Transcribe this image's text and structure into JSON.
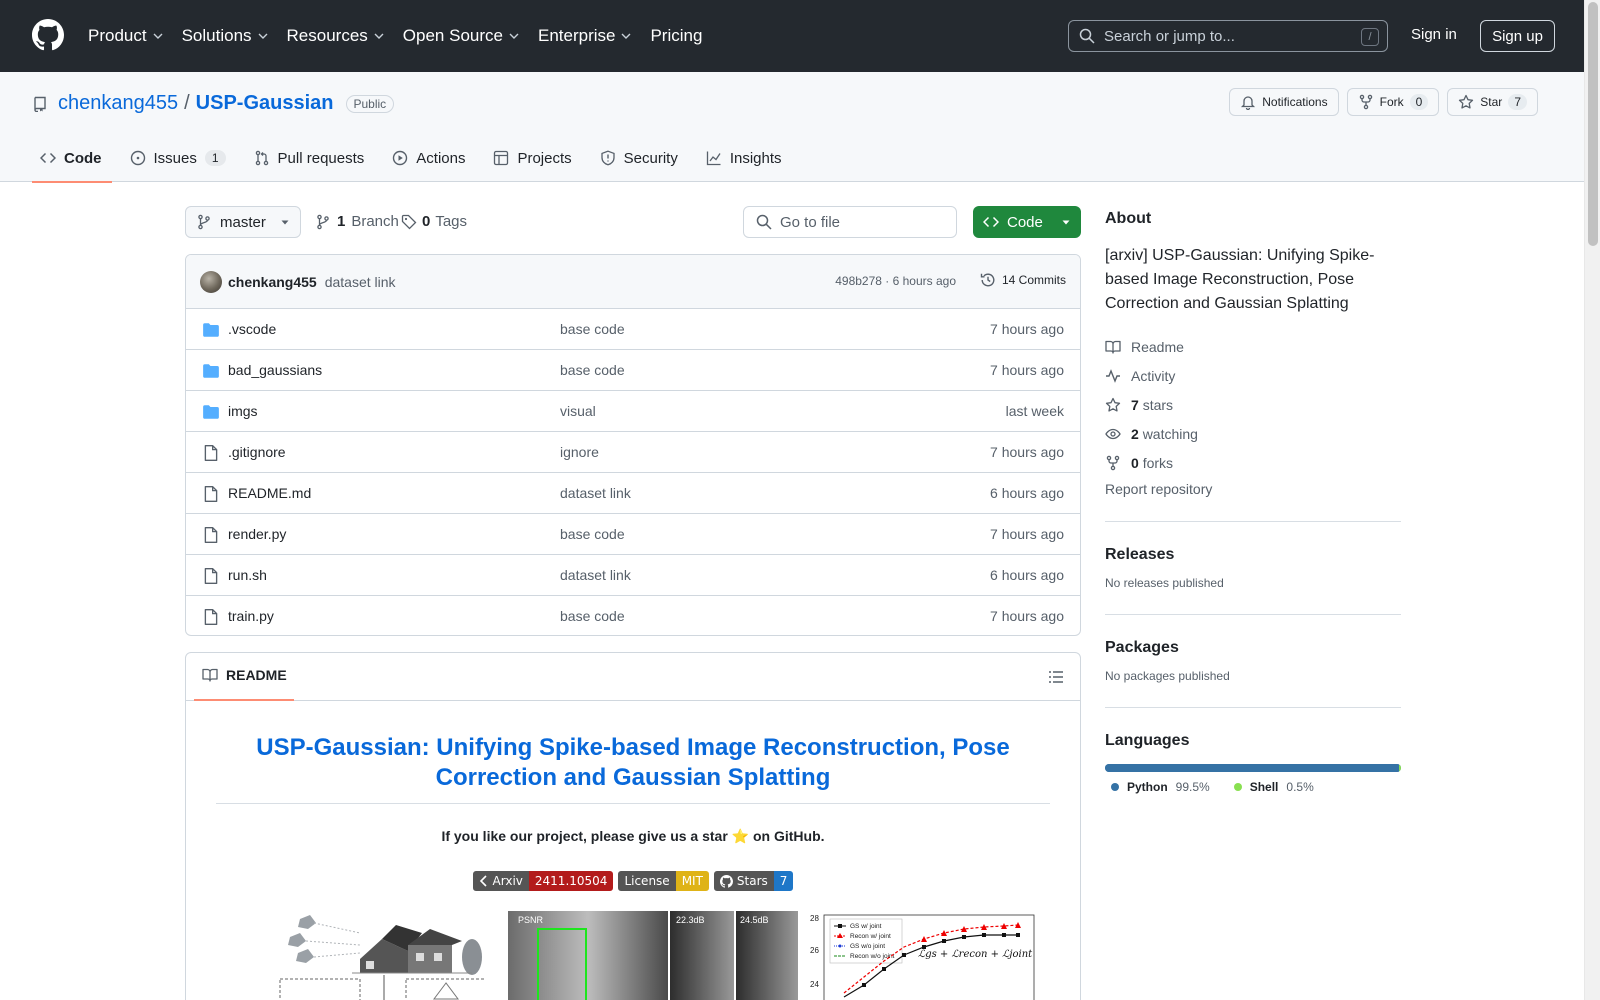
{
  "header": {
    "nav": [
      "Product",
      "Solutions",
      "Resources",
      "Open Source",
      "Enterprise",
      "Pricing"
    ],
    "search_placeholder": "Search or jump to...",
    "search_shortcut": "/",
    "sign_in": "Sign in",
    "sign_up": "Sign up"
  },
  "repo": {
    "owner": "chenkang455",
    "separator": "/",
    "name": "USP-Gaussian",
    "visibility": "Public",
    "notifications_label": "Notifications",
    "fork_label": "Fork",
    "fork_count": "0",
    "star_label": "Star",
    "star_count": "7",
    "tabs": [
      {
        "label": "Code"
      },
      {
        "label": "Issues",
        "count": "1"
      },
      {
        "label": "Pull requests"
      },
      {
        "label": "Actions"
      },
      {
        "label": "Projects"
      },
      {
        "label": "Security"
      },
      {
        "label": "Insights"
      }
    ]
  },
  "toolbar": {
    "branch": "master",
    "branch_count": "1",
    "branch_label": "Branch",
    "tag_count": "0",
    "tag_label": "Tags",
    "goto_placeholder": "Go to file",
    "code_label": "Code"
  },
  "latest_commit": {
    "author": "chenkang455",
    "message": "dataset link",
    "meta": "498b278 · 6 hours ago",
    "commits_label": "14 Commits"
  },
  "files": [
    {
      "type": "folder",
      "name": ".vscode",
      "commit": "base code",
      "time": "7 hours ago"
    },
    {
      "type": "folder",
      "name": "bad_gaussians",
      "commit": "base code",
      "time": "7 hours ago"
    },
    {
      "type": "folder",
      "name": "imgs",
      "commit": "visual",
      "time": "last week"
    },
    {
      "type": "file",
      "name": ".gitignore",
      "commit": "ignore",
      "time": "7 hours ago"
    },
    {
      "type": "file",
      "name": "README.md",
      "commit": "dataset link",
      "time": "6 hours ago"
    },
    {
      "type": "file",
      "name": "render.py",
      "commit": "base code",
      "time": "7 hours ago"
    },
    {
      "type": "file",
      "name": "run.sh",
      "commit": "dataset link",
      "time": "6 hours ago"
    },
    {
      "type": "file",
      "name": "train.py",
      "commit": "base code",
      "time": "7 hours ago"
    }
  ],
  "readme": {
    "tab_label": "README",
    "title": "USP-Gaussian: Unifying Spike-based Image Reconstruction, Pose Correction and Gaussian Splatting",
    "star_note": "If you like our project, please give us a star ⭐ on GitHub.",
    "badges": [
      {
        "left": "Arxiv",
        "right": "2411.10504"
      },
      {
        "left": "License",
        "right": "MIT"
      },
      {
        "left": "Stars",
        "right": "7"
      }
    ],
    "figure_labels": {
      "psnr": "PSNR",
      "db1": "22.3dB",
      "db2": "24.5dB",
      "y_ticks": [
        "28",
        "26",
        "24"
      ],
      "legend": [
        "GS w/ joint",
        "Recon w/ joint",
        "GS w/o joint",
        "Recon w/o joint"
      ]
    }
  },
  "about": {
    "heading": "About",
    "description": "[arxiv] USP-Gaussian: Unifying Spike-based Image Reconstruction, Pose Correction and Gaussian Splatting",
    "readme": "Readme",
    "activity": "Activity",
    "stars_count": "7",
    "stars_label": "stars",
    "watching_count": "2",
    "watching_label": "watching",
    "forks_count": "0",
    "forks_label": "forks",
    "report": "Report repository"
  },
  "releases": {
    "heading": "Releases",
    "empty": "No releases published"
  },
  "packages": {
    "heading": "Packages",
    "empty": "No packages published"
  },
  "languages": {
    "heading": "Languages",
    "items": [
      {
        "name": "Python",
        "percent": "99.5%",
        "share": 0.995,
        "color": "#3572A5"
      },
      {
        "name": "Shell",
        "percent": "0.5%",
        "share": 0.005,
        "color": "#89e051"
      }
    ]
  }
}
